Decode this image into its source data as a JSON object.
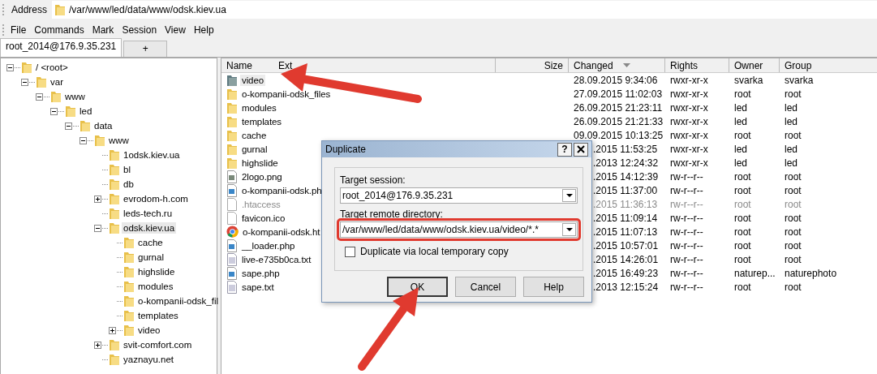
{
  "address": {
    "label": "Address",
    "path": "/var/www/led/data/www/odsk.kiev.ua"
  },
  "menu": [
    "File",
    "Commands",
    "Mark",
    "Session",
    "View",
    "Help"
  ],
  "tabs": [
    {
      "label": "root_2014@176.9.35.231",
      "selected": true
    },
    {
      "label": "+",
      "selected": false
    }
  ],
  "tree": [
    {
      "label": "/ <root>",
      "expanded": true,
      "selected": false,
      "children": [
        {
          "label": "var",
          "expanded": true,
          "selected": false,
          "children": [
            {
              "label": "www",
              "expanded": true,
              "selected": false,
              "children": [
                {
                  "label": "led",
                  "expanded": true,
                  "selected": false,
                  "children": [
                    {
                      "label": "data",
                      "expanded": true,
                      "selected": false,
                      "children": [
                        {
                          "label": "www",
                          "expanded": true,
                          "selected": false,
                          "children": [
                            {
                              "label": "1odsk.kiev.ua",
                              "selected": false
                            },
                            {
                              "label": "bl",
                              "selected": false
                            },
                            {
                              "label": "db",
                              "selected": false
                            },
                            {
                              "label": "evrodom-h.com",
                              "expanded": false,
                              "selected": false
                            },
                            {
                              "label": "leds-tech.ru",
                              "selected": false
                            },
                            {
                              "label": "odsk.kiev.ua",
                              "expanded": true,
                              "selected": true,
                              "children": [
                                {
                                  "label": "cache",
                                  "selected": false
                                },
                                {
                                  "label": "gurnal",
                                  "selected": false
                                },
                                {
                                  "label": "highslide",
                                  "selected": false
                                },
                                {
                                  "label": "modules",
                                  "selected": false
                                },
                                {
                                  "label": "o-kompanii-odsk_fil",
                                  "selected": false
                                },
                                {
                                  "label": "templates",
                                  "selected": false
                                },
                                {
                                  "label": "video",
                                  "expanded": false,
                                  "selected": false
                                }
                              ]
                            },
                            {
                              "label": "svit-comfort.com",
                              "expanded": false,
                              "selected": false
                            },
                            {
                              "label": "yaznayu.net",
                              "selected": false
                            }
                          ]
                        }
                      ]
                    }
                  ]
                }
              ]
            }
          ]
        }
      ]
    }
  ],
  "table": {
    "columns": [
      {
        "label": "Name",
        "sorted": false
      },
      {
        "label": "Ext",
        "sorted": false
      },
      {
        "label": "Size",
        "sorted": false
      },
      {
        "label": "Changed",
        "sorted": true
      },
      {
        "label": "Rights",
        "sorted": false
      },
      {
        "label": "Owner",
        "sorted": false
      },
      {
        "label": "Group",
        "sorted": false
      }
    ],
    "rows": [
      {
        "kind": "folder",
        "name": "video",
        "changed": "28.09.2015 9:34:06",
        "rights": "rwxr-xr-x",
        "owner": "svarka",
        "group": "svarka",
        "selected": true,
        "dimmed": false,
        "covered": false
      },
      {
        "kind": "folder",
        "name": "o-kompanii-odsk_files",
        "changed": "27.09.2015 11:02:03",
        "rights": "rwxr-xr-x",
        "owner": "root",
        "group": "root",
        "selected": false,
        "dimmed": false,
        "covered": false
      },
      {
        "kind": "folder",
        "name": "modules",
        "changed": "26.09.2015 21:23:11",
        "rights": "rwxr-xr-x",
        "owner": "led",
        "group": "led",
        "selected": false,
        "dimmed": false,
        "covered": false
      },
      {
        "kind": "folder",
        "name": "templates",
        "changed": "26.09.2015 21:21:33",
        "rights": "rwxr-xr-x",
        "owner": "led",
        "group": "led",
        "selected": false,
        "dimmed": false,
        "covered": false
      },
      {
        "kind": "folder",
        "name": "cache",
        "changed": "09.09.2015 10:13:25",
        "rights": "rwxr-xr-x",
        "owner": "root",
        "group": "root",
        "selected": false,
        "dimmed": false,
        "covered": false
      },
      {
        "kind": "folder",
        "name": "gurnal",
        "changed": ".2015 11:53:25",
        "rights": "rwxr-xr-x",
        "owner": "led",
        "group": "led",
        "selected": false,
        "dimmed": false,
        "covered": true
      },
      {
        "kind": "folder",
        "name": "highslide",
        "changed": ".2013 12:24:32",
        "rights": "rwxr-xr-x",
        "owner": "led",
        "group": "led",
        "selected": false,
        "dimmed": false,
        "covered": true
      },
      {
        "kind": "image",
        "name": "2logo.png",
        "changed": ".2015 14:12:39",
        "rights": "rw-r--r--",
        "owner": "root",
        "group": "root",
        "selected": false,
        "dimmed": false,
        "covered": true
      },
      {
        "kind": "script",
        "name": "o-kompanii-odsk.ph",
        "changed": ".2015 11:37:00",
        "rights": "rw-r--r--",
        "owner": "root",
        "group": "root",
        "selected": false,
        "dimmed": false,
        "covered": true
      },
      {
        "kind": "file",
        "name": ".htaccess",
        "changed": ".2015 11:36:13",
        "rights": "rw-r--r--",
        "owner": "root",
        "group": "root",
        "selected": false,
        "dimmed": true,
        "covered": true
      },
      {
        "kind": "file",
        "name": "favicon.ico",
        "changed": ".2015 11:09:14",
        "rights": "rw-r--r--",
        "owner": "root",
        "group": "root",
        "selected": false,
        "dimmed": false,
        "covered": true
      },
      {
        "kind": "browser",
        "name": "o-kompanii-odsk.ht",
        "changed": ".2015 11:07:13",
        "rights": "rw-r--r--",
        "owner": "root",
        "group": "root",
        "selected": false,
        "dimmed": false,
        "covered": true
      },
      {
        "kind": "script",
        "name": "__loader.php",
        "changed": ".2015 10:57:01",
        "rights": "rw-r--r--",
        "owner": "root",
        "group": "root",
        "selected": false,
        "dimmed": false,
        "covered": true
      },
      {
        "kind": "text",
        "name": "live-e735b0ca.txt",
        "changed": ".2015 14:26:01",
        "rights": "rw-r--r--",
        "owner": "root",
        "group": "root",
        "selected": false,
        "dimmed": false,
        "covered": true
      },
      {
        "kind": "script",
        "name": "sape.php",
        "changed": ".2015 16:49:23",
        "rights": "rw-r--r--",
        "owner": "naturep...",
        "group": "naturephoto",
        "selected": false,
        "dimmed": false,
        "covered": true
      },
      {
        "kind": "text",
        "name": "sape.txt",
        "changed": ".2013 12:15:24",
        "rights": "rw-r--r--",
        "owner": "root",
        "group": "root",
        "selected": false,
        "dimmed": false,
        "covered": true
      }
    ]
  },
  "dialog": {
    "title": "Duplicate",
    "help": "?",
    "fields": [
      {
        "label": "Target session:",
        "value": "root_2014@176.9.35.231",
        "highlighted": false
      },
      {
        "label": "Target remote directory:",
        "value": "/var/www/led/data/www/odsk.kiev.ua/video/*.*",
        "highlighted": true
      }
    ],
    "checkbox": {
      "label": "Duplicate via local temporary copy",
      "checked": false
    },
    "buttons": [
      {
        "label": "OK",
        "focused": true
      },
      {
        "label": "Cancel",
        "focused": false
      },
      {
        "label": "Help",
        "focused": false
      }
    ]
  }
}
